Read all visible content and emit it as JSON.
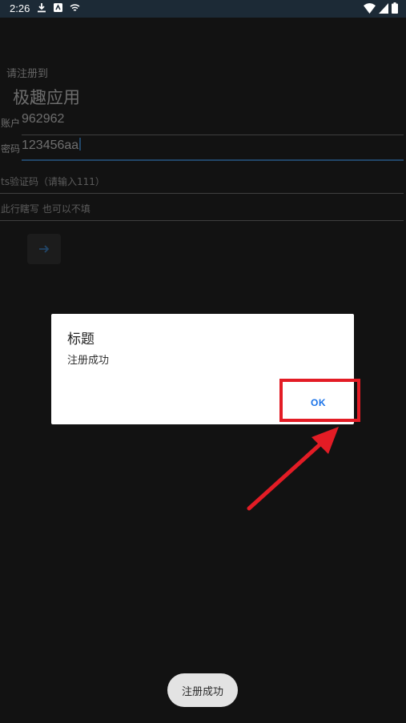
{
  "status_bar": {
    "time": "2:26",
    "icons": [
      "download-icon",
      "app-notification-icon",
      "cast-icon",
      "wifi-icon",
      "cellular-signal-icon",
      "battery-icon"
    ]
  },
  "register": {
    "prompt": "请注册到",
    "app_name": "极趣应用",
    "account_label": "账户",
    "account_value": "962962",
    "password_label": "密码",
    "password_value": "123456aa",
    "code_placeholder": "ts验证码（请输入111）",
    "extra_placeholder": "此行瞎写 也可以不填",
    "submit_icon": "arrow-right-icon"
  },
  "dialog": {
    "title": "标题",
    "message": "注册成功",
    "ok_label": "OK"
  },
  "toast": {
    "message": "注册成功"
  },
  "colors": {
    "background": "#121212",
    "status_bar": "#1c2a36",
    "accent": "#1a73e8",
    "annotation": "#e31c25"
  }
}
